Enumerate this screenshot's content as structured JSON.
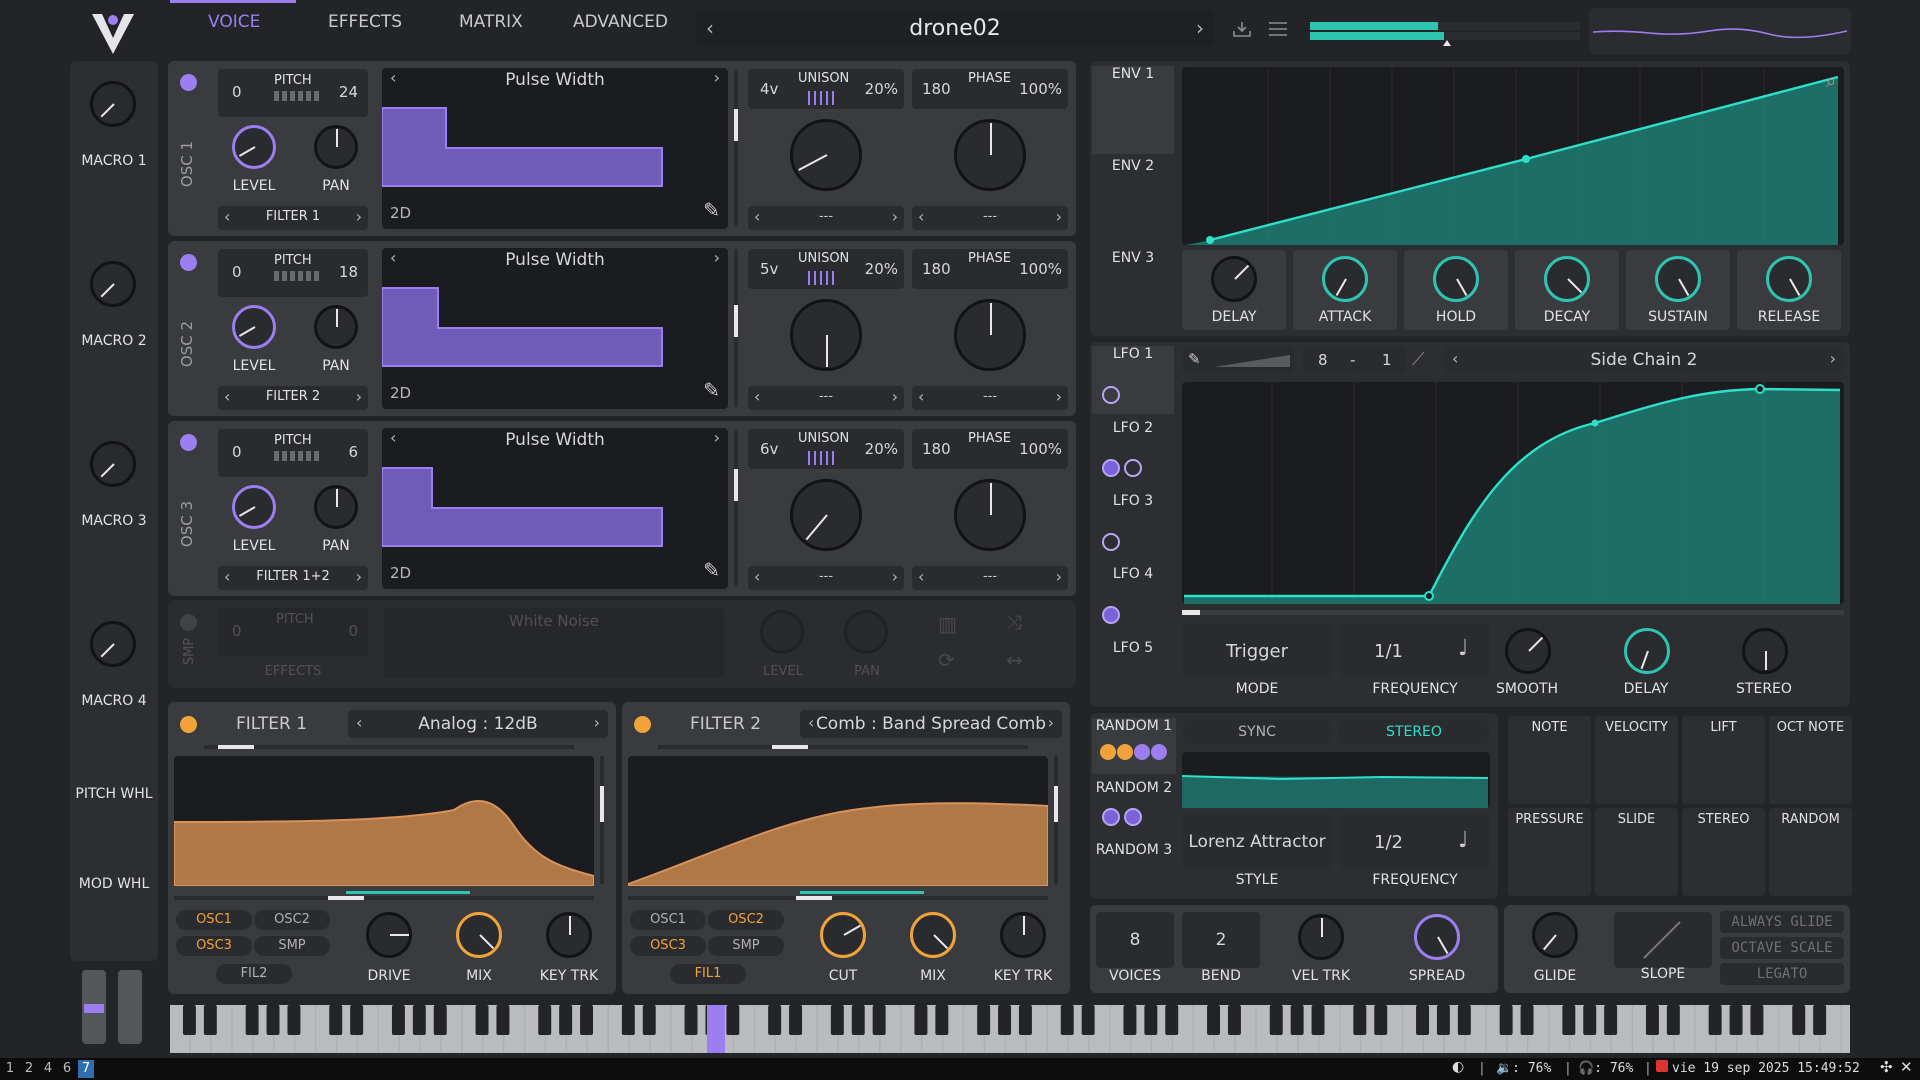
{
  "header": {
    "tabs": [
      "VOICE",
      "EFFECTS",
      "MATRIX",
      "ADVANCED"
    ],
    "preset_name": "drone02"
  },
  "macros": [
    "MACRO 1",
    "MACRO 2",
    "MACRO 3",
    "MACRO 4"
  ],
  "wheels": [
    "PITCH WHL",
    "MOD WHL"
  ],
  "oscillators": [
    {
      "label": "OSC 1",
      "pitch_value": "0",
      "pitch_label": "PITCH",
      "pitch_transpose": "24",
      "wave": "Pulse Width",
      "view": "2D",
      "unison_voices": "4v",
      "unison_label": "UNISON",
      "unison_detune": "20%",
      "phase_value": "180",
      "phase_label": "PHASE",
      "phase_random": "100%",
      "level_label": "LEVEL",
      "pan_label": "PAN",
      "route": "FILTER 1",
      "sel_left": "---",
      "sel_right": "---"
    },
    {
      "label": "OSC 2",
      "pitch_value": "0",
      "pitch_label": "PITCH",
      "pitch_transpose": "18",
      "wave": "Pulse Width",
      "view": "2D",
      "unison_voices": "5v",
      "unison_label": "UNISON",
      "unison_detune": "20%",
      "phase_value": "180",
      "phase_label": "PHASE",
      "phase_random": "100%",
      "level_label": "LEVEL",
      "pan_label": "PAN",
      "route": "FILTER 2",
      "sel_left": "---",
      "sel_right": "---"
    },
    {
      "label": "OSC 3",
      "pitch_value": "0",
      "pitch_label": "PITCH",
      "pitch_transpose": "6",
      "wave": "Pulse Width",
      "view": "2D",
      "unison_voices": "6v",
      "unison_label": "UNISON",
      "unison_detune": "20%",
      "phase_value": "180",
      "phase_label": "PHASE",
      "phase_random": "100%",
      "level_label": "LEVEL",
      "pan_label": "PAN",
      "route": "FILTER 1+2",
      "sel_left": "---",
      "sel_right": "---"
    }
  ],
  "sampler": {
    "label": "SMP",
    "pitch_value": "0",
    "pitch_label": "PITCH",
    "pitch_transpose": "0",
    "sample": "White Noise",
    "route": "EFFECTS",
    "level_label": "LEVEL",
    "pan_label": "PAN"
  },
  "filters": [
    {
      "title": "FILTER 1",
      "model": "Analog",
      "style": "12dB",
      "chips": [
        "OSC1",
        "OSC2",
        "OSC3",
        "SMP"
      ],
      "chip_on": [
        true,
        false,
        true,
        false
      ],
      "other": "FIL2",
      "knobs": [
        "DRIVE",
        "MIX",
        "KEY TRK"
      ]
    },
    {
      "title": "FILTER 2",
      "model": "Comb",
      "style": "Band Spread Comb",
      "chips": [
        "OSC1",
        "OSC2",
        "OSC3",
        "SMP"
      ],
      "chip_on": [
        false,
        true,
        true,
        false
      ],
      "other": "FIL1",
      "knobs": [
        "CUT",
        "MIX",
        "KEY TRK"
      ]
    }
  ],
  "envelopes": {
    "tabs": [
      "ENV 1",
      "ENV 2",
      "ENV 3"
    ],
    "knobs": [
      "DELAY",
      "ATTACK",
      "HOLD",
      "DECAY",
      "SUSTAIN",
      "RELEASE"
    ]
  },
  "lfos": {
    "tabs": [
      "LFO 1",
      "LFO 2",
      "LFO 3",
      "LFO 4",
      "LFO 5"
    ],
    "grid_x": "8",
    "grid_sep": "-",
    "grid_y": "1",
    "shape": "Side Chain 2",
    "mode_value": "Trigger",
    "mode_label": "MODE",
    "freq_value": "1/1",
    "freq_label": "FREQUENCY",
    "knobs": [
      "SMOOTH",
      "DELAY",
      "STEREO"
    ]
  },
  "random": {
    "tabs": [
      "RANDOM 1",
      "RANDOM 2",
      "RANDOM 3"
    ],
    "sync": "SYNC",
    "stereo": "STEREO",
    "style_value": "Lorenz Attractor",
    "style_label": "STYLE",
    "freq_value": "1/2",
    "freq_label": "FREQUENCY"
  },
  "mod_sources": [
    "NOTE",
    "VELOCITY",
    "LIFT",
    "OCT NOTE",
    "PRESSURE",
    "SLIDE",
    "STEREO",
    "RANDOM"
  ],
  "voice": {
    "voices": "8",
    "voices_label": "VOICES",
    "bend": "2",
    "bend_label": "BEND",
    "vel_trk": "VEL TRK",
    "spread": "SPREAD"
  },
  "glide": {
    "glide": "GLIDE",
    "slope": "SLOPE",
    "always_glide": "ALWAYS GLIDE",
    "octave_scale": "OCTAVE SCALE",
    "legato": "LEGATO"
  },
  "taskbar": {
    "workspaces": [
      "1",
      "2",
      "4",
      "6",
      "7"
    ],
    "active_workspace": "7",
    "volume": "🔉: 76%",
    "headphones": "🎧: 76%",
    "datetime": "vie 19 sep 2025 15:49:52"
  },
  "colors": {
    "accent_purple": "#9b7ff0",
    "accent_teal": "#2ec4b0",
    "accent_orange": "#f0a33b"
  }
}
